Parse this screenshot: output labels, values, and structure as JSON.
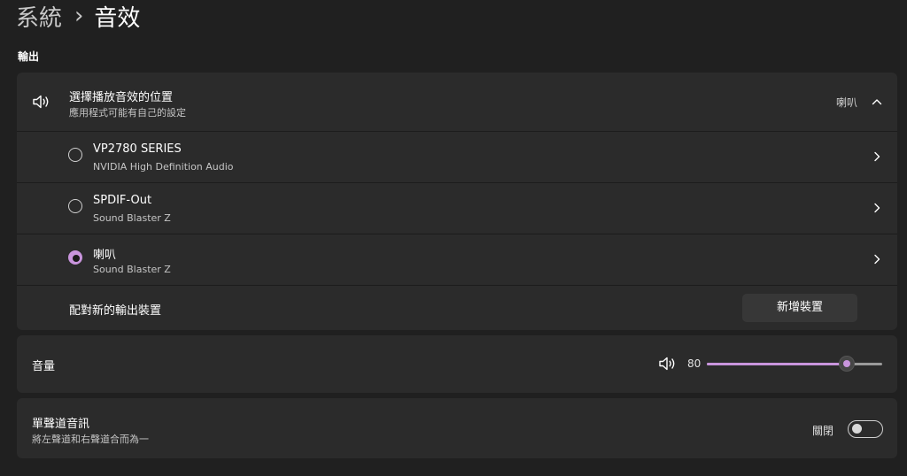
{
  "breadcrumb": {
    "parent": "系統",
    "separator": "›",
    "current": "音效"
  },
  "output_section": {
    "label": "輸出",
    "header": {
      "title": "選擇播放音效的位置",
      "subtitle": "應用程式可能有自己的設定",
      "current_device": "喇叭",
      "icon": "speaker-icon",
      "expanded": true
    },
    "devices": [
      {
        "name": "VP2780 SERIES",
        "driver": "NVIDIA High Definition Audio",
        "selected": false
      },
      {
        "name": "SPDIF-Out",
        "driver": "Sound Blaster Z",
        "selected": false
      },
      {
        "name": "喇叭",
        "driver": "Sound Blaster Z",
        "selected": true
      }
    ],
    "pair": {
      "label": "配對新的輸出裝置",
      "button_label": "新增裝置"
    }
  },
  "volume": {
    "label": "音量",
    "value": "80",
    "level": 0.8,
    "icon": "speaker-icon"
  },
  "mono_audio": {
    "title": "單聲道音訊",
    "subtitle": "將左聲道和右聲道合而為一",
    "state_label": "關閉",
    "on": false
  },
  "colors": {
    "accent": "#c995dd",
    "background": "#202020",
    "card": "#2b2b2b"
  }
}
